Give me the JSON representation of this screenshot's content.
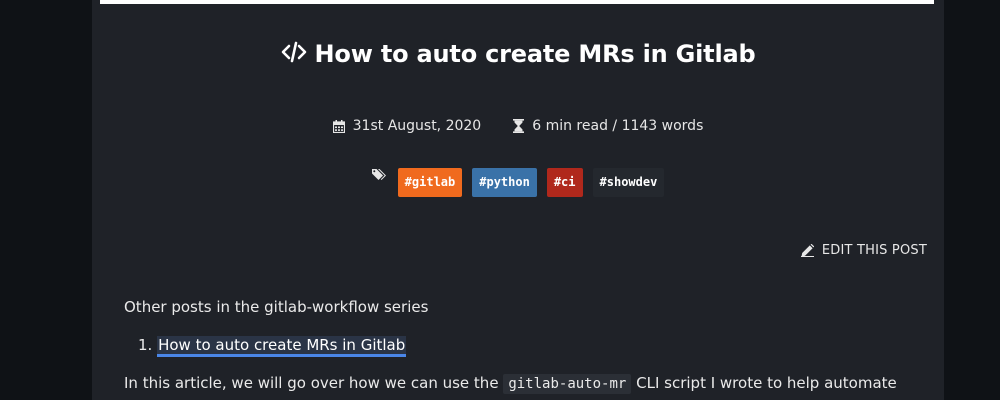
{
  "colors": {
    "page_background": "#0f1216",
    "panel_background": "#1f2228",
    "link_underline": "#4a86e8",
    "tag_gitlab": "#f06a1e",
    "tag_python": "#3a72a8",
    "tag_ci": "#b0281c",
    "tag_showdev": "#24282e"
  },
  "post": {
    "title_icon": "code-icon",
    "title": "How to auto create MRs in Gitlab",
    "date_icon": "calendar-icon",
    "date": "31st August, 2020",
    "read_icon": "hourglass-icon",
    "read_time": "6 min read / 1143 words",
    "tags_icon": "tags-icon",
    "tags": [
      {
        "label": "#gitlab"
      },
      {
        "label": "#python"
      },
      {
        "label": "#ci"
      },
      {
        "label": "#showdev"
      }
    ],
    "edit_icon": "pencil-icon",
    "edit_label": "EDIT THIS POST"
  },
  "content": {
    "series_intro": "Other posts in the gitlab-workflow series",
    "series_items": [
      {
        "number": "1.",
        "label": "How to auto create MRs in Gitlab"
      }
    ],
    "article_text_before": "In this article, we will go over how we can use the",
    "article_code": "gitlab-auto-mr",
    "article_text_after": "CLI script I wrote to help automate"
  }
}
